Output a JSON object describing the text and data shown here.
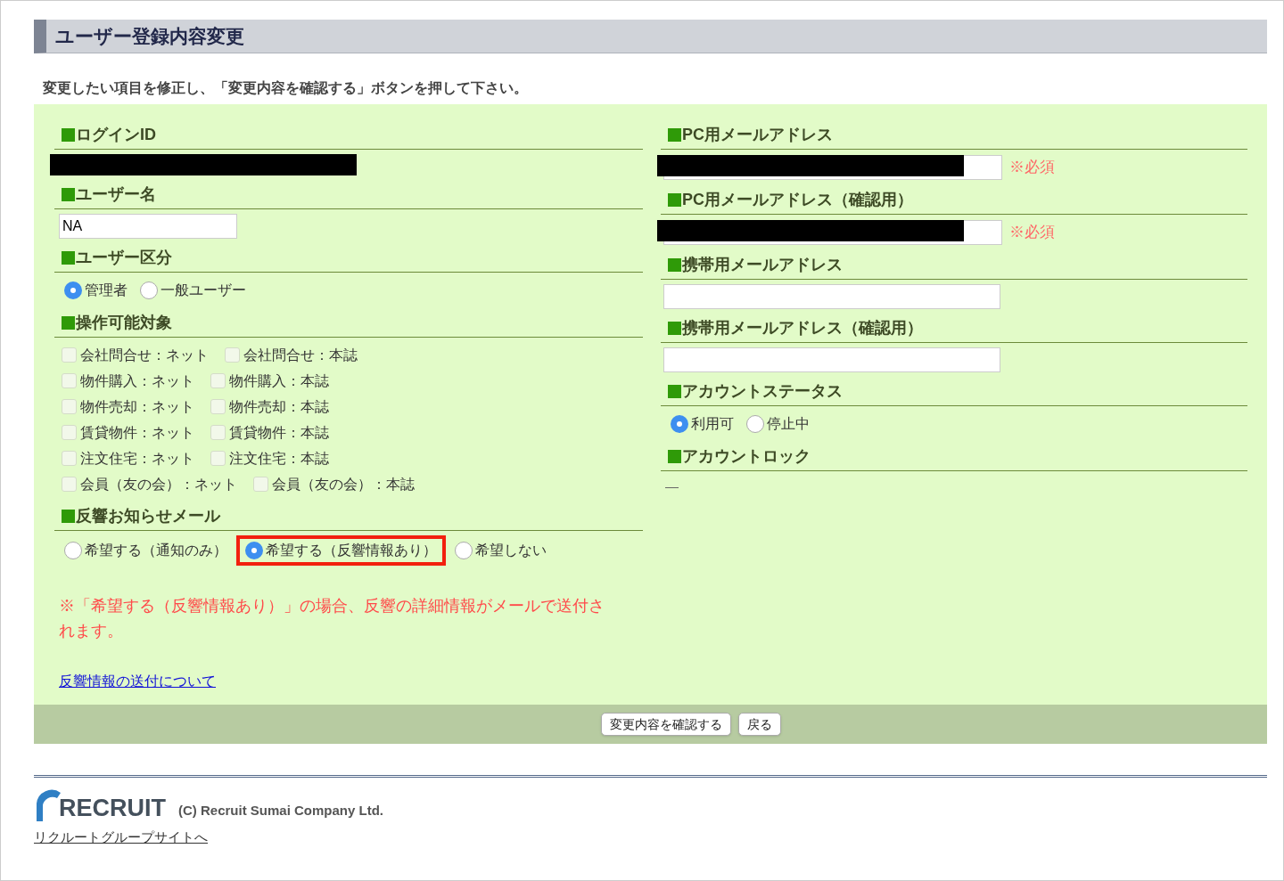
{
  "title": "ユーザー登録内容変更",
  "instruction": "変更したい項目を修正し、「変更内容を確認する」ボタンを押して下さい。",
  "left_sections": [
    {
      "kind": "redacted",
      "label": "ログインID"
    },
    {
      "kind": "text_field",
      "label": "ユーザー名",
      "value": "NA"
    },
    {
      "kind": "radio",
      "label": "ユーザー区分",
      "options": [
        {
          "label": "管理者",
          "selected": true,
          "highlighted": false
        },
        {
          "label": "一般ユーザー",
          "selected": false,
          "highlighted": false
        }
      ]
    },
    {
      "kind": "checkboxes",
      "label": "操作可能対象",
      "rows": [
        [
          {
            "label": "会社問合せ：ネット",
            "checked": false
          },
          {
            "label": "会社問合せ：本誌",
            "checked": false
          }
        ],
        [
          {
            "label": "物件購入：ネット",
            "checked": false
          },
          {
            "label": "物件購入：本誌",
            "checked": false
          }
        ],
        [
          {
            "label": "物件売却：ネット",
            "checked": false
          },
          {
            "label": "物件売却：本誌",
            "checked": false
          }
        ],
        [
          {
            "label": "賃貸物件：ネット",
            "checked": false
          },
          {
            "label": "賃貸物件：本誌",
            "checked": false
          }
        ],
        [
          {
            "label": "注文住宅：ネット",
            "checked": false
          },
          {
            "label": "注文住宅：本誌",
            "checked": false
          }
        ],
        [
          {
            "label": "会員（友の会）：ネット",
            "checked": false
          },
          {
            "label": "会員（友の会）：本誌",
            "checked": false
          }
        ]
      ]
    },
    {
      "kind": "radio",
      "label": "反響お知らせメール",
      "options": [
        {
          "label": "希望する（通知のみ）",
          "selected": false,
          "highlighted": false
        },
        {
          "label": "希望する（反響情報あり）",
          "selected": true,
          "highlighted": true
        },
        {
          "label": "希望しない",
          "selected": false,
          "highlighted": false
        }
      ]
    }
  ],
  "note": "※「希望する（反響情報あり）」の場合、反響の詳細情報がメールで送付されます。",
  "link": "反響情報の送付について",
  "right_sections": [
    {
      "kind": "redacted_field",
      "label": "PC用メールアドレス",
      "required": "※必須"
    },
    {
      "kind": "redacted_field",
      "label": "PC用メールアドレス（確認用）",
      "required": "※必須"
    },
    {
      "kind": "text_field",
      "label": "携帯用メールアドレス"
    },
    {
      "kind": "text_field",
      "label": "携帯用メールアドレス（確認用）"
    },
    {
      "kind": "radio",
      "label": "アカウントステータス",
      "options": [
        {
          "label": "利用可",
          "selected": true,
          "highlighted": false
        },
        {
          "label": "停止中",
          "selected": false,
          "highlighted": false
        }
      ]
    },
    {
      "kind": "text",
      "label": "アカウントロック",
      "value": "—"
    }
  ],
  "buttons": [
    "変更内容を確認する",
    "戻る"
  ],
  "footer": {
    "logo_text": "RECRUIT",
    "copyright": "(C) Recruit Sumai Company Ltd.",
    "link": "リクルートグループサイトへ"
  }
}
